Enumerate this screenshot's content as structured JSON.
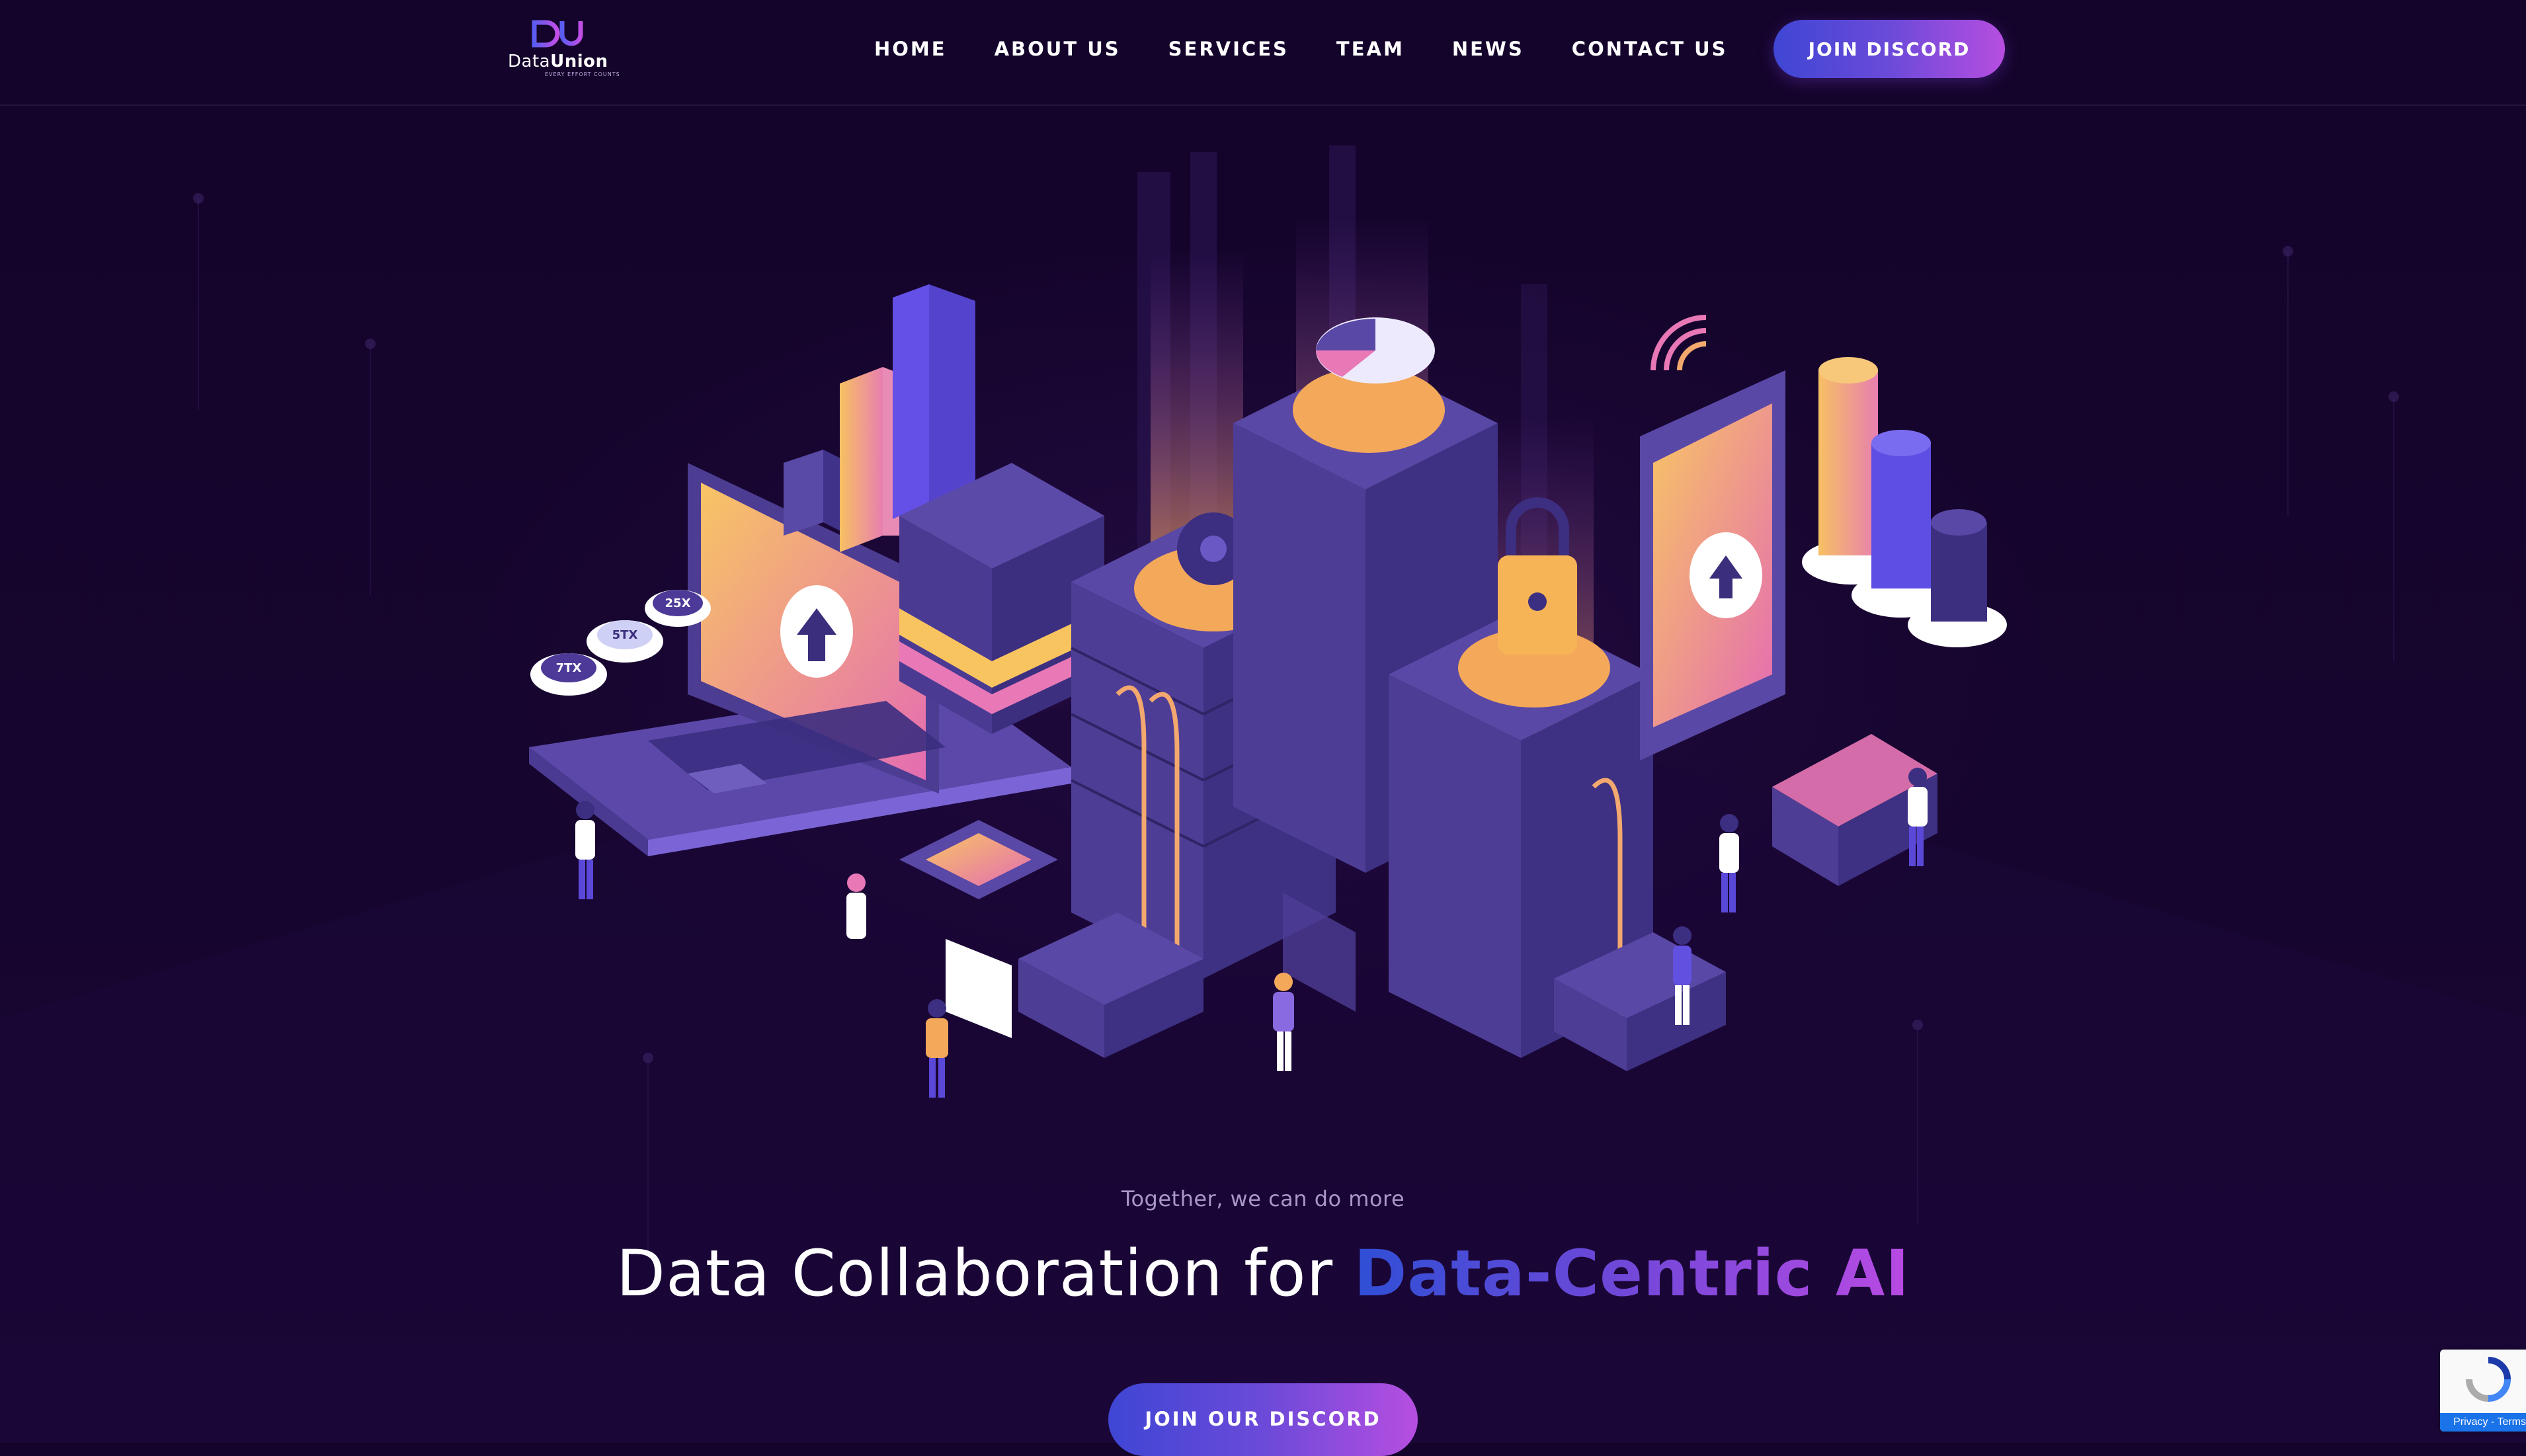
{
  "header": {
    "logo": {
      "monogram": "DU",
      "word_a": "Data",
      "word_b": "Union",
      "tagline": "EVERY EFFORT COUNTS"
    },
    "nav": [
      "HOME",
      "ABOUT US",
      "SERVICES",
      "TEAM",
      "NEWS",
      "CONTACT US"
    ],
    "cta_label": "JOIN DISCORD"
  },
  "hero": {
    "tagline": "Together, we can do more",
    "headline_plain": "Data Collaboration for ",
    "headline_accent": "Data-Centric AI",
    "cta_label": "JOIN OUR DISCORD",
    "coin_labels": [
      "25X",
      "5TX",
      "7TX"
    ]
  },
  "recaptcha": {
    "links": "Privacy - Terms"
  },
  "colors": {
    "background": "#14042b",
    "accent_start": "#3f46d4",
    "accent_end": "#b64ee0",
    "illustration_purple": "#4e3c8d",
    "illustration_orange": "#f7bb62",
    "illustration_pink": "#e66ab0"
  }
}
